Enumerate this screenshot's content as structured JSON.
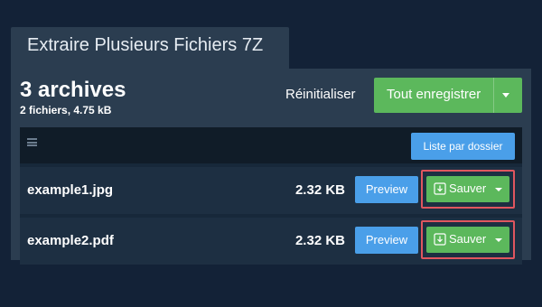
{
  "window": {
    "title": "Extraire Plusieurs Fichiers 7Z"
  },
  "summary": {
    "title": "3 archives",
    "subtitle": "2 fichiers, 4.75 kB"
  },
  "actions": {
    "reset_label": "Réinitialiser",
    "save_all_label": "Tout enregistrer"
  },
  "list": {
    "view_toggle_label": "Liste par dossier",
    "menu_icon": "hamburger-menu-icon",
    "files": [
      {
        "name": "example1.jpg",
        "size": "2.32 KB",
        "preview_label": "Preview",
        "save_label": "Sauver"
      },
      {
        "name": "example2.pdf",
        "size": "2.32 KB",
        "preview_label": "Preview",
        "save_label": "Sauver"
      }
    ]
  },
  "colors": {
    "background": "#132237",
    "panel": "#2b3d50",
    "primary_blue": "#4a9fe9",
    "success_green": "#5cb85c",
    "highlight_red": "#e0565f"
  }
}
